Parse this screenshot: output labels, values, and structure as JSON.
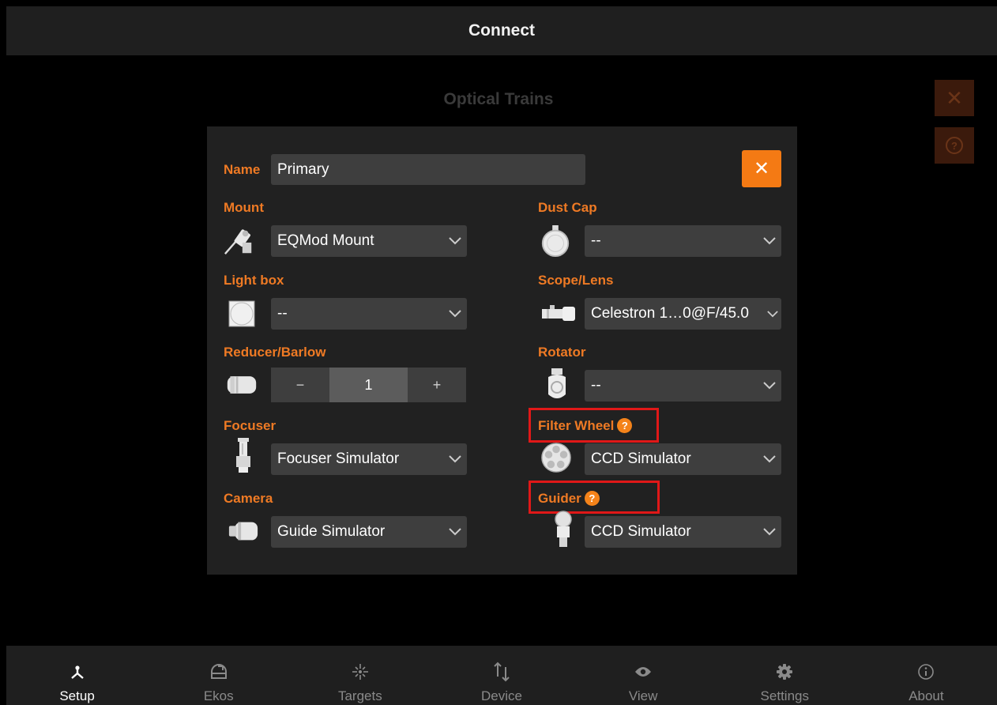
{
  "header": {
    "title": "Connect"
  },
  "backdrop": {
    "title": "Optical Trains"
  },
  "side_buttons": {
    "close_icon": "close-icon",
    "help_icon": "help-icon",
    "close_glyph": "✕",
    "help_glyph": "?"
  },
  "dialog": {
    "name_label": "Name",
    "name_value": "Primary",
    "close_glyph": "✕",
    "left": {
      "mount": {
        "label": "Mount",
        "value": "EQMod Mount",
        "icon": "mount-icon"
      },
      "light_box": {
        "label": "Light box",
        "value": "--",
        "icon": "light-box-icon"
      },
      "reducer": {
        "label": "Reducer/Barlow",
        "value": "1",
        "minus": "−",
        "plus": "+",
        "icon": "reducer-icon"
      },
      "focuser": {
        "label": "Focuser",
        "value": "Focuser Simulator",
        "icon": "focuser-icon"
      },
      "camera": {
        "label": "Camera",
        "value": "Guide Simulator",
        "icon": "camera-icon"
      }
    },
    "right": {
      "dust_cap": {
        "label": "Dust Cap",
        "value": "--",
        "icon": "dust-cap-icon"
      },
      "scope": {
        "label": "Scope/Lens",
        "value": "Celestron 1…0@F/45.0",
        "icon": "scope-icon"
      },
      "rotator": {
        "label": "Rotator",
        "value": "--",
        "icon": "rotator-icon"
      },
      "filter_wheel": {
        "label": "Filter Wheel",
        "value": "CCD Simulator",
        "icon": "filter-wheel-icon",
        "help": "?"
      },
      "guider": {
        "label": "Guider",
        "value": "CCD Simulator",
        "icon": "guider-icon",
        "help": "?"
      }
    }
  },
  "tabs": [
    {
      "label": "Setup",
      "icon": "setup-icon",
      "active": true
    },
    {
      "label": "Ekos",
      "icon": "ekos-icon"
    },
    {
      "label": "Targets",
      "icon": "targets-icon"
    },
    {
      "label": "Device",
      "icon": "device-icon"
    },
    {
      "label": "View",
      "icon": "view-icon"
    },
    {
      "label": "Settings",
      "icon": "settings-icon"
    },
    {
      "label": "About",
      "icon": "about-icon"
    }
  ],
  "colors": {
    "accent": "#ef7a24",
    "highlight": "#e01818",
    "panel": "#212121",
    "field": "#3e3e3e"
  }
}
